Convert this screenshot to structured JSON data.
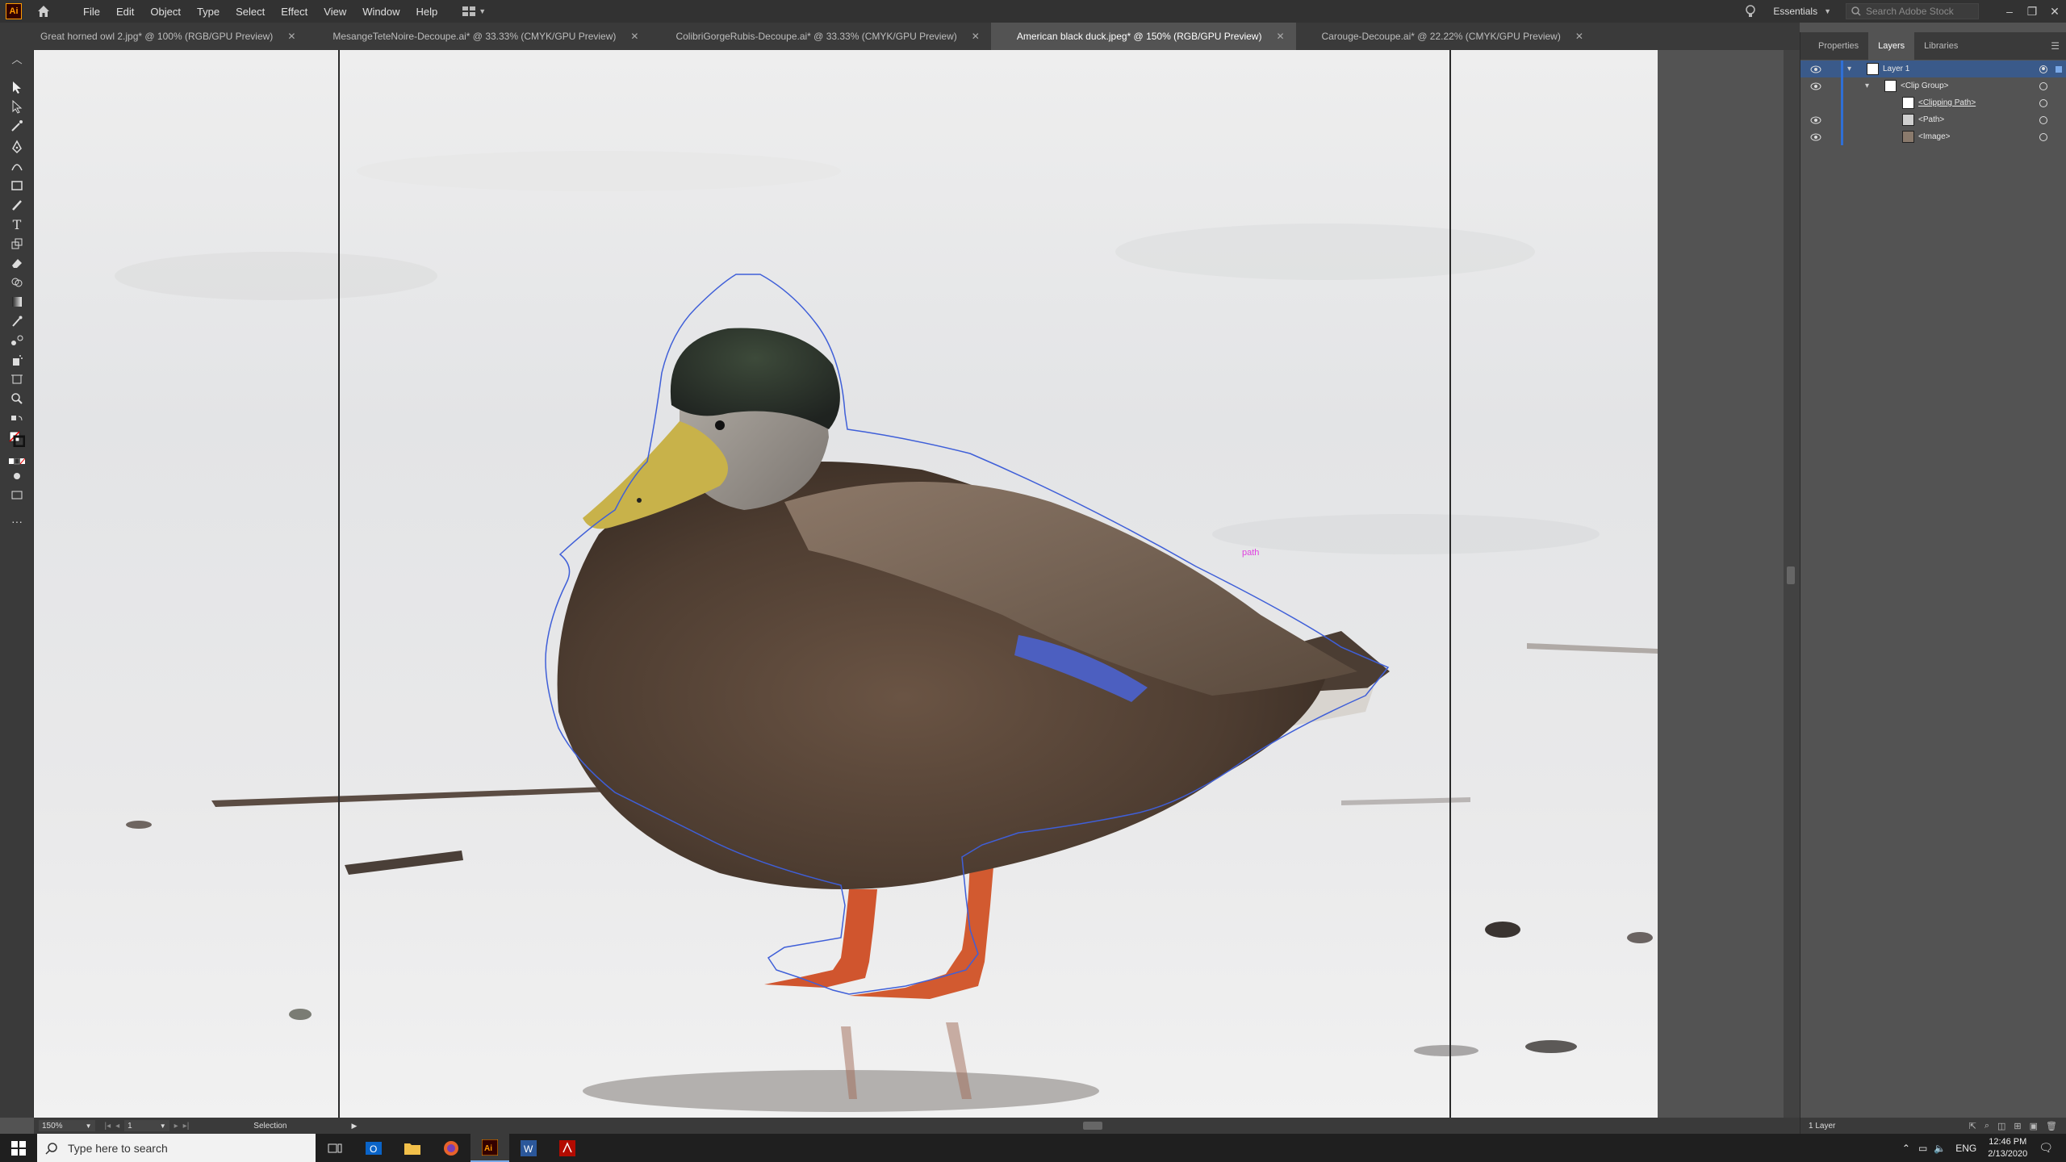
{
  "app": {
    "logo_text": "Ai",
    "menu": [
      "File",
      "Edit",
      "Object",
      "Type",
      "Select",
      "Effect",
      "View",
      "Window",
      "Help"
    ],
    "workspace": "Essentials",
    "search_placeholder": "Search Adobe Stock"
  },
  "tabs": [
    {
      "label": "Great horned owl 2.jpg* @ 100% (RGB/GPU Preview)",
      "active": false
    },
    {
      "label": "MesangeTeteNoire-Decoupe.ai* @ 33.33% (CMYK/GPU Preview)",
      "active": false
    },
    {
      "label": "ColibriGorgeRubis-Decoupe.ai* @ 33.33% (CMYK/GPU Preview)",
      "active": false
    },
    {
      "label": "American black duck.jpeg* @ 150% (RGB/GPU Preview)",
      "active": true
    },
    {
      "label": "Carouge-Decoupe.ai* @ 22.22% (CMYK/GPU Preview)",
      "active": false
    }
  ],
  "canvas": {
    "path_label": "path"
  },
  "panel": {
    "tabs": [
      "Properties",
      "Layers",
      "Libraries"
    ],
    "active_tab": "Layers",
    "layers": [
      {
        "name": "Layer 1"
      },
      {
        "name": "<Clip Group>"
      },
      {
        "name": "<Clipping Path>"
      },
      {
        "name": "<Path>"
      },
      {
        "name": "<Image>"
      }
    ],
    "footer": "1 Layer"
  },
  "status": {
    "zoom": "150%",
    "artboard": "1",
    "tool": "Selection"
  },
  "taskbar": {
    "search_placeholder": "Type here to search",
    "language": "ENG",
    "time": "12:46 PM",
    "date": "2/13/2020"
  },
  "colors": {
    "accent": "#2f6fd6",
    "ai_brand": "#ff9a00",
    "path_outline": "#3f5fd8",
    "path_label": "#e040e0"
  }
}
